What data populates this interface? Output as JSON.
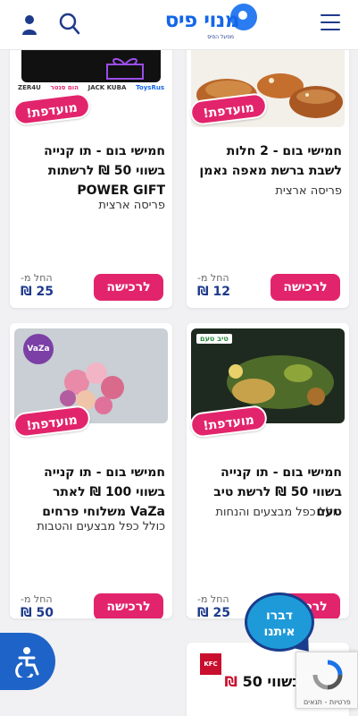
{
  "header": {
    "logo_text": "מנוי פיס",
    "logo_sub": "מפעל הפיס"
  },
  "cards": [
    {
      "badge": "מועדפת!",
      "title": "חמישי בום - 2 חלות לשבת ברשת מאפה נאמן",
      "desc": "פריסה ארצית",
      "from": "החל מ-",
      "price": "12 ₪",
      "buy": "לרכישה"
    },
    {
      "badge": "מועדפת!",
      "title": "חמישי בום - תו קנייה בשווי 50 ₪ לרשתות POWER GIFT",
      "desc": "פריסה ארצית",
      "from": "החל מ-",
      "price": "25 ₪",
      "buy": "לרכישה",
      "brands": [
        "ZER4U",
        "הום סנטר",
        "JACK KUBA",
        "ToysRus"
      ]
    },
    {
      "badge": "מועדפת!",
      "title": "חמישי בום - תו קנייה בשווי 50 ₪ לרשת טיב טעם",
      "desc": "כולל כפל מבצעים והנחות",
      "from": "החל מ-",
      "price": "25 ₪",
      "buy": "לרכישה",
      "image_logo": "טיב טעם"
    },
    {
      "badge": "מועדפת!",
      "title": "חמישי בום - תו קנייה בשווי 100 ₪ לאתר VaZa משלוחי פרחים",
      "desc": "כולל כפל מבצעים והטבות",
      "from": "החל מ-",
      "price": "50 ₪",
      "buy": "לרכישה",
      "image_logo": "VaZa"
    }
  ],
  "partial_card": {
    "image_text": "קנייה בשווי 50",
    "currency": "₪",
    "brand": "KFC"
  },
  "chat": {
    "label": "דברו איתנו"
  },
  "recaptcha": {
    "legal": "פרטיות - תנאים"
  },
  "colors": {
    "brand_blue": "#1466e8",
    "navy": "#1e3a8a",
    "accent_pink": "#e2246c"
  }
}
